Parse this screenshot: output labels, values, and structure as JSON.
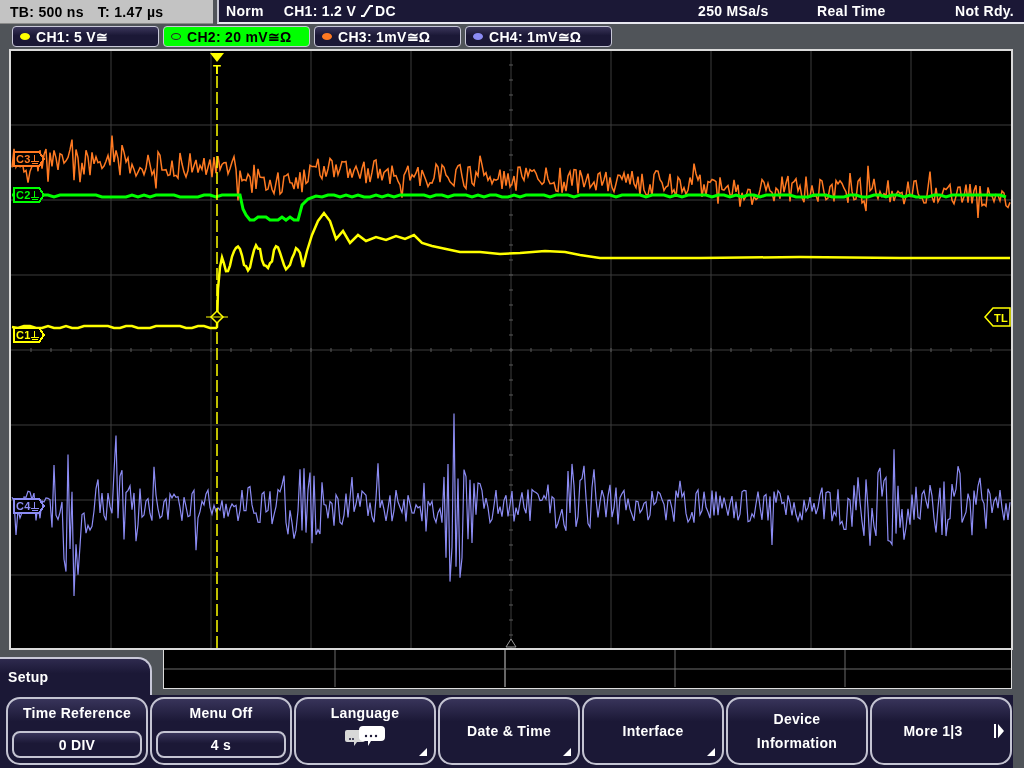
{
  "status_bar": {
    "timebase": "TB: 500 ns",
    "trigger_time": "T: 1.47 µs",
    "trigger_mode": "Norm",
    "trigger_source": "CH1: 1.2 V",
    "trigger_coupling": "DC",
    "sample_rate": "250 MSa/s",
    "acquisition": "Real Time",
    "status": "Not Rdy."
  },
  "channels": [
    {
      "label": "CH1: 5 V≅",
      "color": "#ffff00",
      "selected": false
    },
    {
      "label": "CH2: 20 mV≅Ω",
      "color": "#00ff00",
      "selected": true
    },
    {
      "label": "CH3: 1mV≅Ω",
      "color": "#ff7a22",
      "selected": false
    },
    {
      "label": "CH4: 1mV≅Ω",
      "color": "#8c8cf4",
      "selected": false
    }
  ],
  "display": {
    "trigger_label": "T",
    "trigger_level_label": "TL",
    "markers": [
      {
        "label": "C3",
        "color": "#ff7a22"
      },
      {
        "label": "C2",
        "color": "#00ff00"
      },
      {
        "label": "C1",
        "color": "#ffff00"
      },
      {
        "label": "C4",
        "color": "#8c8cf4"
      }
    ]
  },
  "menu": {
    "title": "Setup",
    "buttons": [
      {
        "kind": "value",
        "label": "Time Reference",
        "value": "0 DIV"
      },
      {
        "kind": "value",
        "label": "Menu Off",
        "value": "4 s"
      },
      {
        "kind": "icon",
        "label": "Language",
        "submenu": true
      },
      {
        "kind": "text",
        "label": "Date & Time",
        "submenu": true
      },
      {
        "kind": "text",
        "label": "Interface",
        "submenu": true
      },
      {
        "kind": "text",
        "label": "Device Information",
        "submenu": false
      },
      {
        "kind": "next",
        "label": "More 1|3"
      }
    ]
  }
}
